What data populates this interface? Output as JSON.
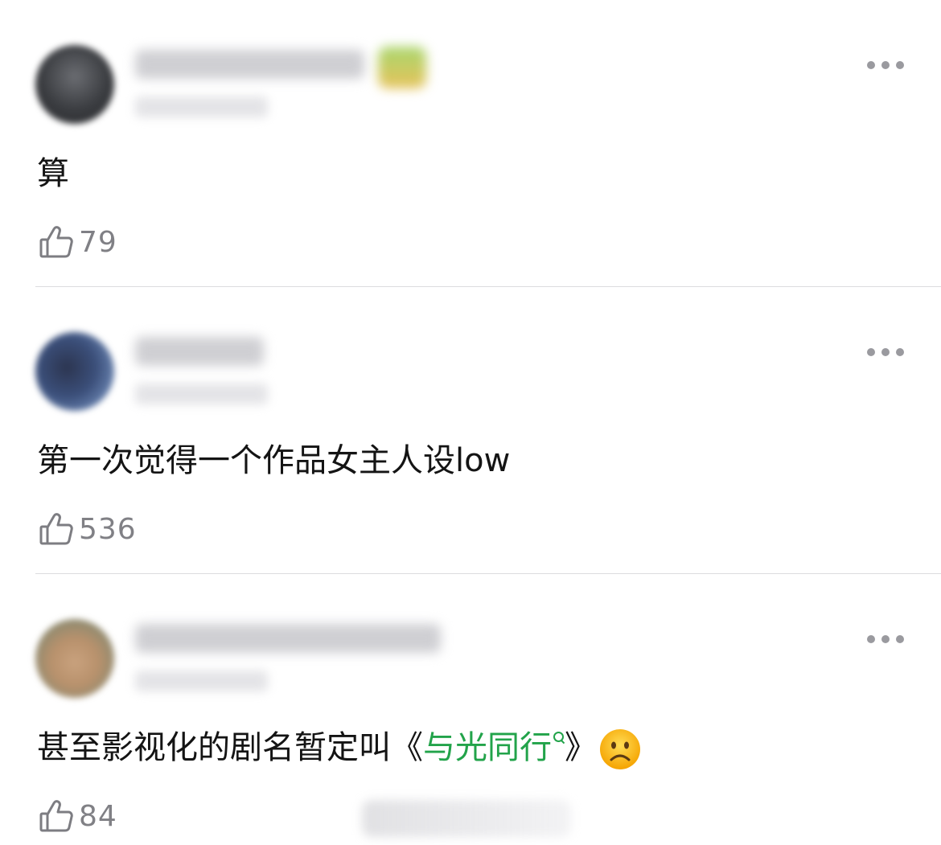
{
  "comments": [
    {
      "text": "算",
      "likes": "79"
    },
    {
      "text": "第一次觉得一个作品女主人设low",
      "likes": "536"
    },
    {
      "text_before": "甚至影视化的剧名暂定叫《",
      "topic": "与光同行",
      "text_after": "》",
      "emoji": "frowning-face",
      "likes": "84"
    }
  ],
  "colors": {
    "topic_link": "#22a34a",
    "like_count": "#808085",
    "divider": "#dcdcdf"
  },
  "icons": {
    "like": "thumbs-up-icon",
    "more": "more-dots-icon",
    "topic_search": "search-icon"
  }
}
